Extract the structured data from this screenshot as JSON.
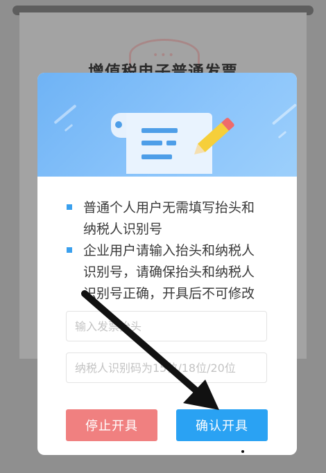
{
  "background_page": {
    "title": "增值税电子普通发票"
  },
  "dialog": {
    "notes": [
      "普通个人用户无需填写抬头和纳税人识别号",
      "企业用户请输入抬头和纳税人识别号，请确保抬头和纳税人识别号正确，开具后不可修改"
    ],
    "notes_lines": [
      [
        "普通个人用户无需填写抬头和",
        "纳税人识别号"
      ],
      [
        "企业用户请输入抬头和纳税人",
        "识别号，请确保抬头和纳税人",
        "识别号正确，开具后不可修改"
      ]
    ],
    "invoice_title_placeholder": "输入发票抬头",
    "tax_id_placeholder": "纳税人识别码为15位/18位/20位",
    "stop_button": "停止开具",
    "confirm_button": "确认开具"
  },
  "colors": {
    "confirm": "#2aa2f3",
    "stop": "#f08080",
    "bullet": "#3aa0ee",
    "banner": "#7ab9f7"
  },
  "icons": [
    "invoice-document-icon",
    "pencil-icon",
    "arrow-annotation"
  ]
}
